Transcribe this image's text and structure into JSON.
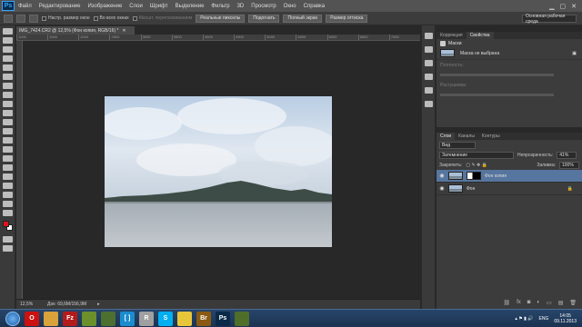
{
  "app": {
    "logo": "Ps"
  },
  "menu": [
    "Файл",
    "Редактирование",
    "Изображение",
    "Слои",
    "Шрифт",
    "Выделение",
    "Фильтр",
    "3D",
    "Просмотр",
    "Окно",
    "Справка"
  ],
  "options": {
    "fit_screen": "Настр. размер окон",
    "all_windows": "Во всех окнах",
    "scrubby_zoom": "Масшт. перетаскиванием",
    "actual_pixels": "Реальные пикселы",
    "fit_button": "Подогнать",
    "full_screen": "Полный экран",
    "print_size": "Размер оттиска",
    "workspace": "Основная рабочая среда"
  },
  "document": {
    "tab_title": "IMG_7424.CR2 @ 12,5% (Фон копия, RGB/16) *",
    "zoom": "12,5%",
    "doc_info": "Док: 69,6M/156,9M",
    "ruler_ticks": [
      "1000",
      "1500",
      "2000",
      "2500",
      "3000",
      "3500",
      "4000",
      "4500",
      "5000",
      "5500",
      "6000",
      "6500",
      "7000"
    ]
  },
  "properties": {
    "tabs": [
      "Коррекция",
      "Свойства"
    ],
    "active_tab": 1,
    "title": "Маски",
    "mask_status": "Маска не выбрана",
    "density_label": "Плотность:",
    "feather_label": "Растушевка:"
  },
  "layers": {
    "tabs": [
      "Слои",
      "Каналы",
      "Контуры"
    ],
    "filter": "Вид",
    "blend_mode": "Затемнение",
    "opacity_label": "Непрозрачность:",
    "opacity_value": "41%",
    "lock_label": "Закрепить:",
    "fill_label": "Заливка:",
    "fill_value": "100%",
    "items": [
      {
        "name": "Фон копия",
        "selected": true
      },
      {
        "name": "Фон",
        "selected": false
      }
    ]
  },
  "taskbar": {
    "apps": [
      {
        "icon": "opera-icon",
        "label": "O",
        "color": "#cc1111"
      },
      {
        "icon": "folder-icon",
        "label": "",
        "color": "#d9a23a"
      },
      {
        "icon": "filezilla-icon",
        "label": "Fz",
        "color": "#b31b1b"
      },
      {
        "icon": "greenapp-icon",
        "label": "",
        "color": "#6b8f2a"
      },
      {
        "icon": "media-icon",
        "label": "",
        "color": "#4d6f30"
      },
      {
        "icon": "bracket-icon",
        "label": "[ ]",
        "color": "#1a8ccf"
      },
      {
        "icon": "r-icon",
        "label": "R",
        "color": "#a0a0a0"
      },
      {
        "icon": "skype-icon",
        "label": "S",
        "color": "#00aff0"
      },
      {
        "icon": "chrome-icon",
        "label": "",
        "color": "#e8c63a"
      },
      {
        "icon": "bridge-icon",
        "label": "Br",
        "color": "#8a5a12"
      },
      {
        "icon": "photoshop-icon",
        "label": "Ps",
        "color": "#0b2a4a"
      },
      {
        "icon": "tool-icon",
        "label": "",
        "color": "#4f6e2a"
      }
    ],
    "language": "ENG",
    "time": "14:05",
    "date": "09.11.2013"
  }
}
